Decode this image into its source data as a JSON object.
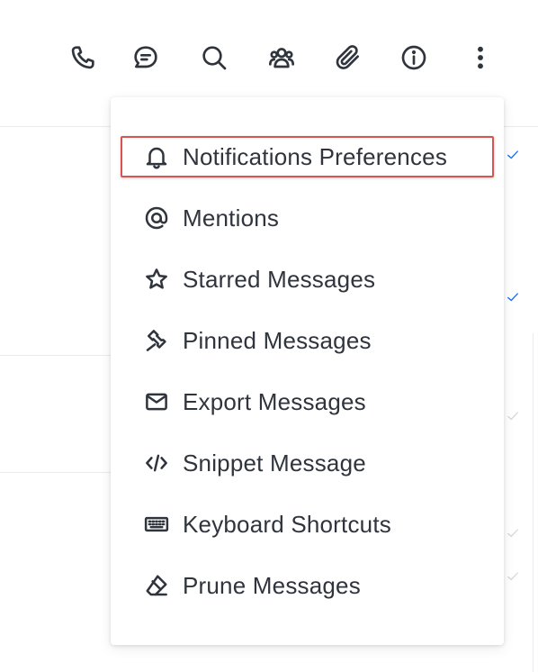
{
  "toolbar": {
    "icons": [
      {
        "name": "phone-icon",
        "label": "Call"
      },
      {
        "name": "discussion-icon",
        "label": "Discussion"
      },
      {
        "name": "search-icon",
        "label": "Search"
      },
      {
        "name": "members-icon",
        "label": "Members"
      },
      {
        "name": "attachment-icon",
        "label": "Files"
      },
      {
        "name": "info-icon",
        "label": "Room Info"
      },
      {
        "name": "kebab-menu-icon",
        "label": "Options"
      }
    ]
  },
  "menu": {
    "items": [
      {
        "label": "Notifications Preferences",
        "icon": "bell-icon",
        "highlighted": true
      },
      {
        "label": "Mentions",
        "icon": "at-icon"
      },
      {
        "label": "Starred Messages",
        "icon": "star-icon"
      },
      {
        "label": "Pinned Messages",
        "icon": "pin-icon"
      },
      {
        "label": "Export Messages",
        "icon": "envelope-icon"
      },
      {
        "label": "Snippet Message",
        "icon": "code-icon"
      },
      {
        "label": "Keyboard Shortcuts",
        "icon": "keyboard-icon"
      },
      {
        "label": "Prune Messages",
        "icon": "eraser-icon"
      }
    ]
  },
  "colors": {
    "text": "#2f343d",
    "highlight_border": "#d9534f",
    "read_check_blue": "#1d74f5",
    "faint_check": "#d6d9de",
    "divider": "#e9ebee"
  }
}
